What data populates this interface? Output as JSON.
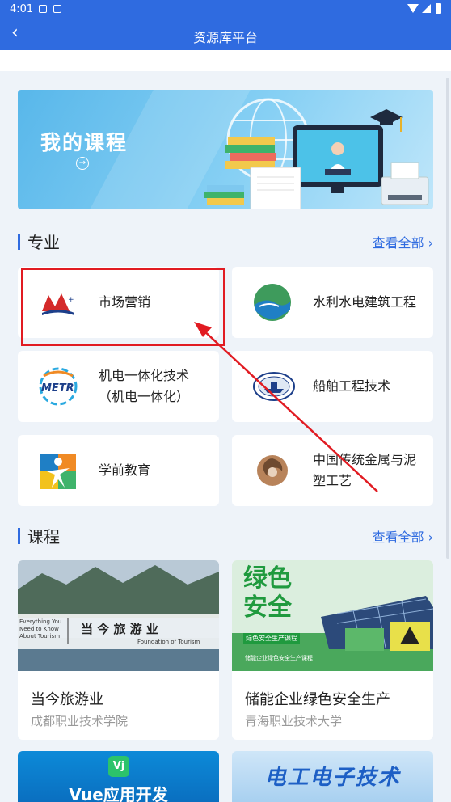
{
  "status_bar": {
    "time": "4:01"
  },
  "app_bar": {
    "title": "资源库平台"
  },
  "banner": {
    "title": "我的课程"
  },
  "majors_section": {
    "title": "专业",
    "view_all": "查看全部",
    "items": [
      {
        "name": "市场营销",
        "icon": "marketing-logo"
      },
      {
        "name": "水利水电建筑工程",
        "icon": "water-conservancy-logo"
      },
      {
        "name": "机电一体化技术（机电一体化）",
        "icon": "metr-logo"
      },
      {
        "name": "船舶工程技术",
        "icon": "ship-engineering-logo"
      },
      {
        "name": "学前教育",
        "icon": "preschool-logo"
      },
      {
        "name": "中国传统金属与泥塑工艺",
        "icon": "metal-craft-logo"
      }
    ]
  },
  "courses_section": {
    "title": "课程",
    "view_all": "查看全部",
    "items": [
      {
        "title": "当今旅游业",
        "school": "成都职业技术学院",
        "thumb_text": "当 今 旅 游 业",
        "thumb_en_left": "Everything You Need to Know About Tourism",
        "thumb_en_right": "Foundation of Tourism"
      },
      {
        "title": "储能企业绿色安全生产",
        "school": "青海职业技术大学",
        "thumb_text_1": "绿色",
        "thumb_text_2": "安全",
        "thumb_sub": "绿色安全生产课程",
        "thumb_sub2": "储能企业绿色安全生产课程"
      },
      {
        "title": "Vue应用开发",
        "badge": "Vj"
      },
      {
        "title": "电工电子技术"
      }
    ]
  }
}
